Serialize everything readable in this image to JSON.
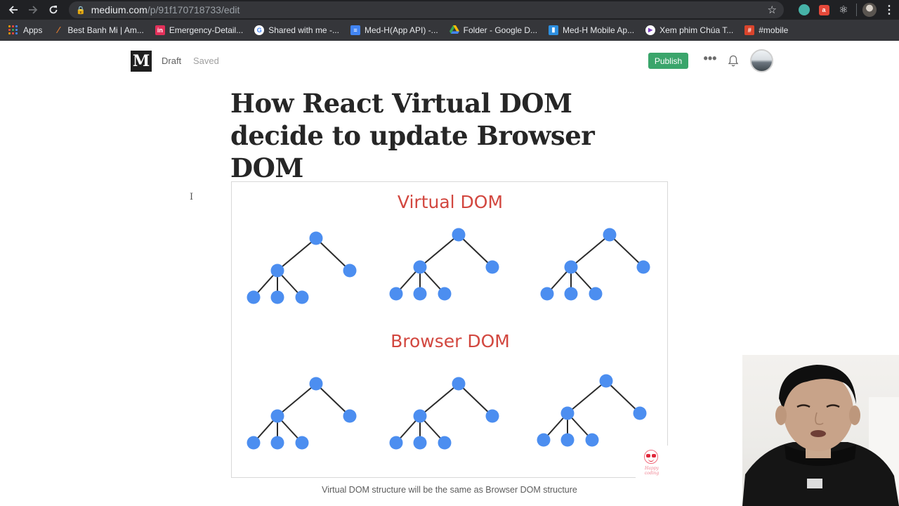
{
  "browser": {
    "url_host": "medium.com",
    "url_path": "/p/91f170718733/edit",
    "icons": {
      "back": "arrow-left-icon",
      "forward": "arrow-right-icon",
      "reload": "reload-icon",
      "lock": "lock-icon",
      "bookmark_star": "star-icon",
      "menu": "kebab-menu-icon"
    },
    "bookmarks": [
      {
        "label": "Apps",
        "icon": "apps-grid-icon"
      },
      {
        "label": "Best Banh Mi | Am...",
        "icon": "banh-mi-icon"
      },
      {
        "label": "Emergency-Detail...",
        "icon": "invision-icon"
      },
      {
        "label": "Shared with me -...",
        "icon": "google-icon"
      },
      {
        "label": "Med-H(App API) -...",
        "icon": "google-docs-icon"
      },
      {
        "label": "Folder - Google D...",
        "icon": "google-drive-icon"
      },
      {
        "label": "Med-H Mobile Ap...",
        "icon": "trello-icon"
      },
      {
        "label": "Xem phim Chúa T...",
        "icon": "play-icon"
      },
      {
        "label": "#mobile",
        "icon": "slack-icon"
      }
    ]
  },
  "medium": {
    "logo_letter": "M",
    "status_draft": "Draft",
    "status_saved": "Saved",
    "publish_label": "Publish",
    "more_glyph": "•••",
    "title": "How React Virtual DOM decide to update Browser DOM",
    "cursor_glyph": "I",
    "figure": {
      "heading_top": "Virtual DOM",
      "heading_bottom": "Browser DOM",
      "node_color": "#4c8ef0",
      "heading_color": "#d2473f",
      "sticker_text": "Happy coding"
    },
    "caption": "Virtual DOM structure will be the same as Browser DOM structure"
  },
  "colors": {
    "chrome_dark": "#202124",
    "bookmarks_bar": "#35363a",
    "publish_green": "#3aa56b",
    "title_text": "#262626"
  }
}
